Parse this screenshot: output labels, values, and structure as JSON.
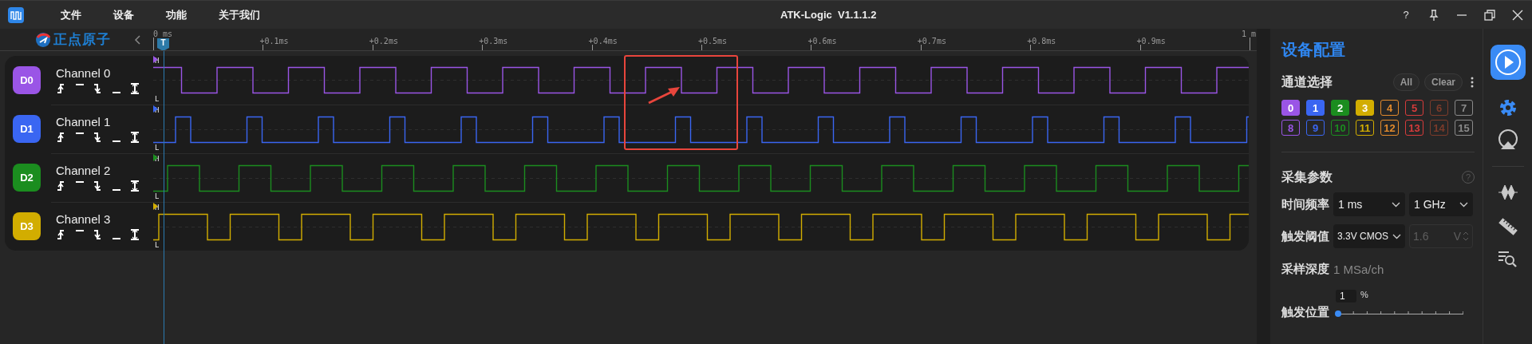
{
  "title_bar": {
    "menu": [
      "文件",
      "设备",
      "功能",
      "关于我们"
    ],
    "title": "ATK-Logic  V1.1.1.2",
    "help": "?"
  },
  "logo": {
    "text": "正点原子"
  },
  "ruler": {
    "trigger_label": "T",
    "ticks": [
      "0 ms",
      "+0.1ms",
      "+0.2ms",
      "+0.3ms",
      "+0.4ms",
      "+0.5ms",
      "+0.6ms",
      "+0.7ms",
      "+0.8ms",
      "+0.9ms",
      "1 m"
    ]
  },
  "channels": [
    {
      "badge": "D0",
      "name": "Channel 0",
      "color": "#9a55e6",
      "high_mark": "H",
      "low_mark": "L"
    },
    {
      "badge": "D1",
      "name": "Channel 1",
      "color": "#3a66f2",
      "high_mark": "H",
      "low_mark": "L"
    },
    {
      "badge": "D2",
      "name": "Channel 2",
      "color": "#1b8d1f",
      "high_mark": "H",
      "low_mark": "L"
    },
    {
      "badge": "D3",
      "name": "Channel 3",
      "color": "#d2ad00",
      "high_mark": "H",
      "low_mark": "L"
    }
  ],
  "config": {
    "title": "设备配置",
    "channel_select": {
      "heading": "通道选择",
      "buttons": [
        "All",
        "Clear"
      ],
      "chips": [
        {
          "label": "0",
          "selected": true,
          "color": "#9a55e6"
        },
        {
          "label": "1",
          "selected": true,
          "color": "#3a66f2"
        },
        {
          "label": "2",
          "selected": true,
          "color": "#1b8d1f"
        },
        {
          "label": "3",
          "selected": true,
          "color": "#d2ad00"
        },
        {
          "label": "4",
          "selected": false,
          "color": "#e28a2c"
        },
        {
          "label": "5",
          "selected": false,
          "color": "#d63b3b"
        },
        {
          "label": "6",
          "selected": false,
          "color": "#7c3b2a"
        },
        {
          "label": "7",
          "selected": false,
          "color": "#8a8a8a"
        },
        {
          "label": "8",
          "selected": false,
          "color": "#9a55e6"
        },
        {
          "label": "9",
          "selected": false,
          "color": "#3a66f2"
        },
        {
          "label": "10",
          "selected": false,
          "color": "#1b8d1f"
        },
        {
          "label": "11",
          "selected": false,
          "color": "#d2ad00"
        },
        {
          "label": "12",
          "selected": false,
          "color": "#e28a2c"
        },
        {
          "label": "13",
          "selected": false,
          "color": "#d63b3b"
        },
        {
          "label": "14",
          "selected": false,
          "color": "#7c3b2a"
        },
        {
          "label": "15",
          "selected": false,
          "color": "#8a8a8a"
        }
      ]
    },
    "acquisition": {
      "heading": "采集参数",
      "help": "?",
      "sample_time": {
        "label": "时间频率",
        "time_value": "1 ms",
        "rate_value": "1 GHz"
      },
      "threshold": {
        "label": "触发阈值",
        "value": "3.3V CMOS",
        "voltage": "1.6",
        "unit": "V",
        "voltage_disabled": true
      },
      "depth": {
        "label": "采样深度",
        "value": "1 MSa/ch"
      },
      "trigger_position": {
        "label": "触发位置",
        "value": "1",
        "unit": "%",
        "level": 0.01
      }
    }
  },
  "tools": [
    {
      "kind": "run",
      "selected": false
    },
    {
      "kind": "settings",
      "selected": true
    },
    {
      "kind": "trigger",
      "selected": false
    },
    {
      "kind": "decode",
      "selected": false
    },
    {
      "kind": "measure",
      "selected": false
    },
    {
      "kind": "search",
      "selected": false
    }
  ]
}
